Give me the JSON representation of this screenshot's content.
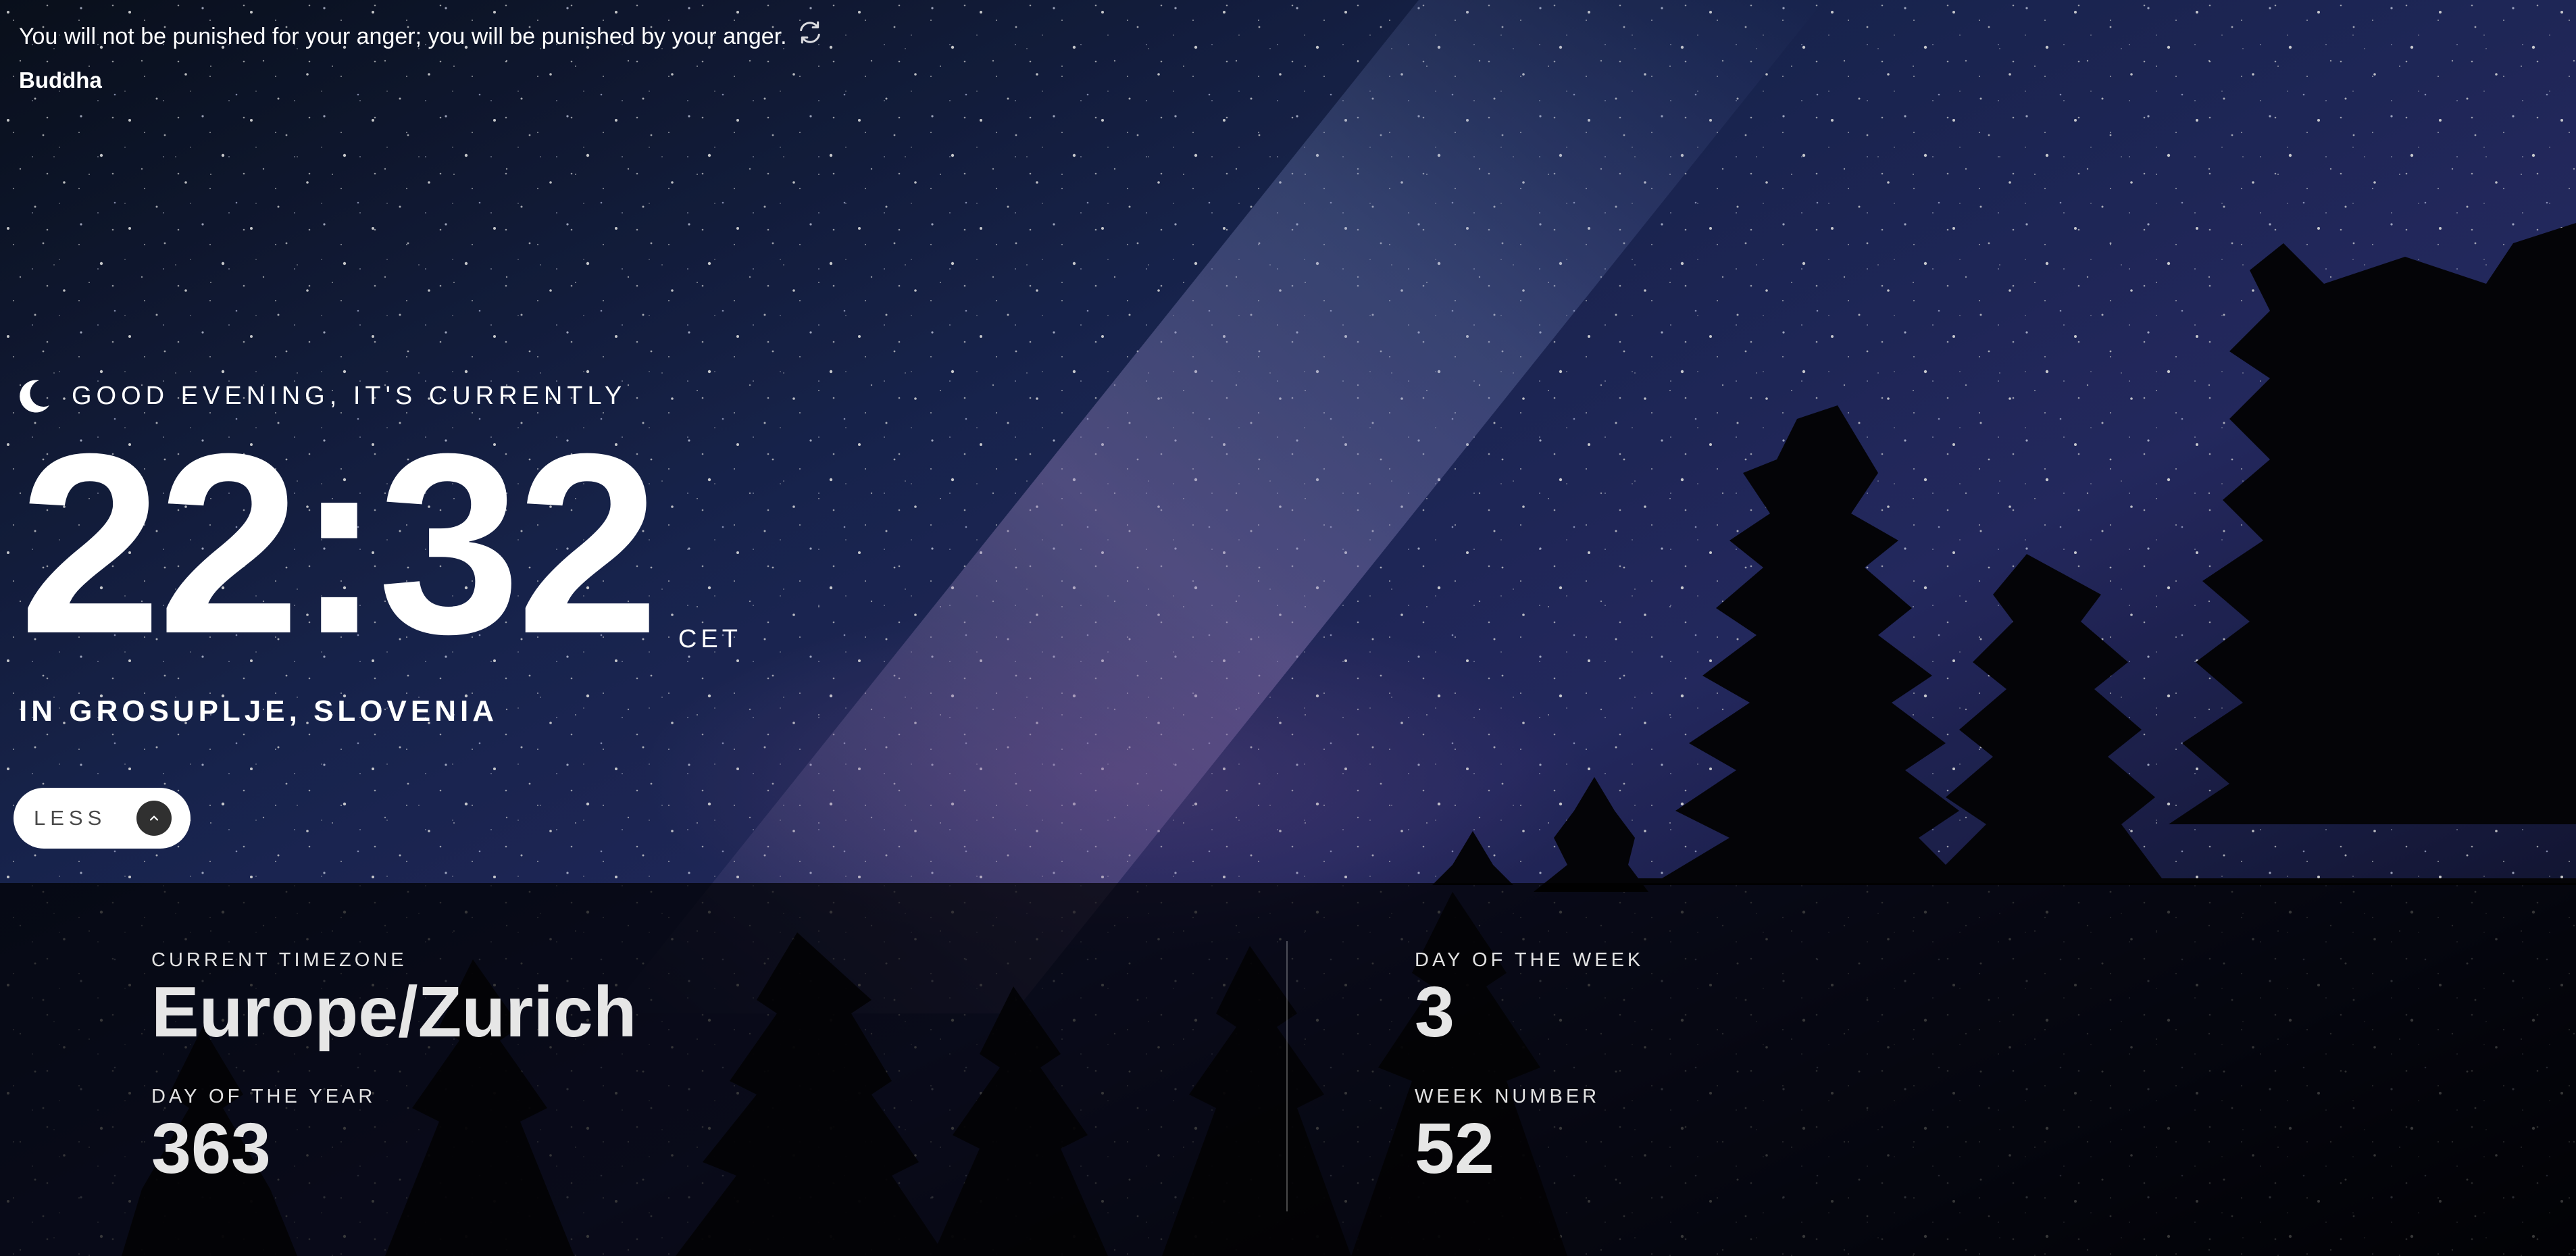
{
  "quote": {
    "text": "You will not be punished for your anger; you will be punished by your anger.",
    "author": "Buddha"
  },
  "greeting": {
    "icon": "moon-icon",
    "text": "GOOD EVENING, IT'S CURRENTLY"
  },
  "clock": {
    "time": "22:32",
    "zone_abbr": "CET",
    "location": "IN GROSUPLJE, SLOVENIA"
  },
  "toggle": {
    "label": "LESS",
    "icon": "chevron-up-icon"
  },
  "details": {
    "timezone": {
      "label": "CURRENT TIMEZONE",
      "value": "Europe/Zurich"
    },
    "day_of_year": {
      "label": "DAY OF THE YEAR",
      "value": "363"
    },
    "day_of_week": {
      "label": "DAY OF THE WEEK",
      "value": "3"
    },
    "week_number": {
      "label": "WEEK NUMBER",
      "value": "52"
    }
  },
  "colors": {
    "text": "#ffffff",
    "button_bg": "#ffffff",
    "chevron_bg": "#303030",
    "panel_bg": "#000000"
  }
}
